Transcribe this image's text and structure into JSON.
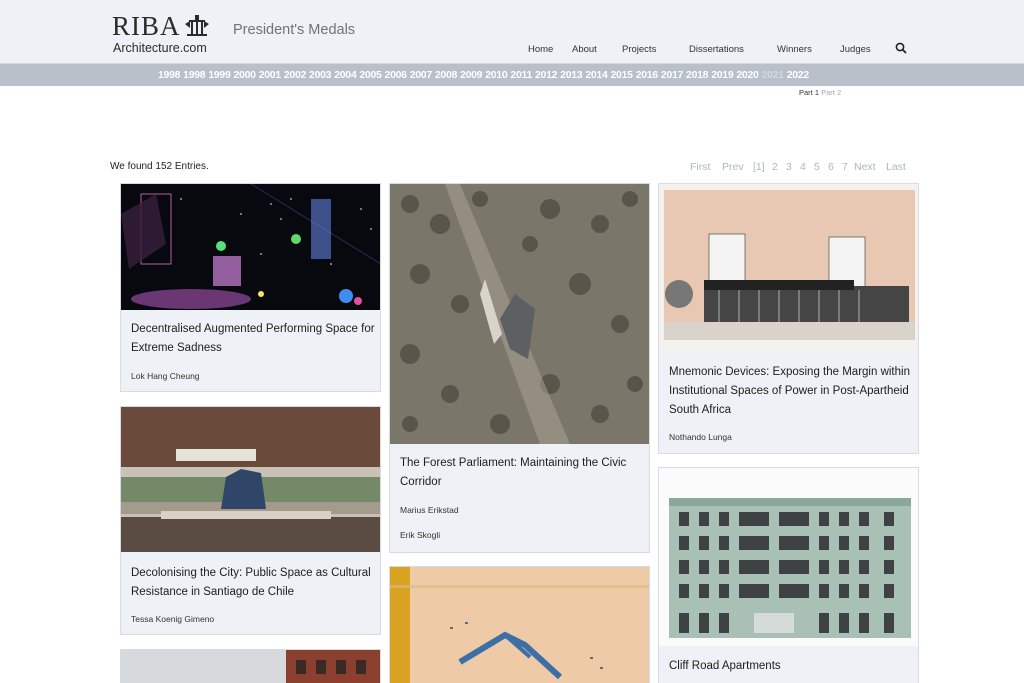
{
  "header": {
    "logo_riba": "RIBA",
    "logo_sub": "Architecture.com",
    "site_title": "President's Medals"
  },
  "nav": {
    "items": [
      {
        "label": "Home"
      },
      {
        "label": "About"
      },
      {
        "label": "Projects"
      },
      {
        "label": "Dissertations"
      },
      {
        "label": "Winners"
      },
      {
        "label": "Judges"
      }
    ],
    "search_icon": "search-icon"
  },
  "years": [
    {
      "label": "1998",
      "active": true
    },
    {
      "label": "1998",
      "active": true
    },
    {
      "label": "1999",
      "active": true
    },
    {
      "label": "2000",
      "active": true
    },
    {
      "label": "2001",
      "active": true
    },
    {
      "label": "2002",
      "active": true
    },
    {
      "label": "2003",
      "active": true
    },
    {
      "label": "2004",
      "active": true
    },
    {
      "label": "2005",
      "active": true
    },
    {
      "label": "2006",
      "active": true
    },
    {
      "label": "2007",
      "active": true
    },
    {
      "label": "2008",
      "active": true
    },
    {
      "label": "2009",
      "active": true
    },
    {
      "label": "2010",
      "active": true
    },
    {
      "label": "2011",
      "active": true
    },
    {
      "label": "2012",
      "active": true
    },
    {
      "label": "2013",
      "active": true
    },
    {
      "label": "2014",
      "active": true
    },
    {
      "label": "2015",
      "active": true
    },
    {
      "label": "2016",
      "active": true
    },
    {
      "label": "2017",
      "active": true
    },
    {
      "label": "2018",
      "active": true
    },
    {
      "label": "2019",
      "active": true
    },
    {
      "label": "2020",
      "active": true
    },
    {
      "label": "2021",
      "active": false
    },
    {
      "label": "2022",
      "active": true
    }
  ],
  "parts": {
    "part1": "Part 1",
    "part2": "Part 2"
  },
  "results": {
    "found_text": "We found 152 Entries."
  },
  "pager": {
    "first": "First",
    "prev": "Prev",
    "current": "[1]",
    "pages": [
      "2",
      "3",
      "4",
      "5",
      "6",
      "7"
    ],
    "next": "Next",
    "last": "Last"
  },
  "cards": [
    {
      "title": "Decentralised Augmented Performing Space for Extreme Sadness",
      "authors": [
        "Lok Hang Cheung"
      ]
    },
    {
      "title": "Decolonising the City: Public Space as Cultural Resistance in Santiago de Chile",
      "authors": [
        "Tessa Koenig Gimeno"
      ]
    },
    {
      "title": "The Forest Parliament: Maintaining the Civic Corridor",
      "authors": [
        "Marius Erikstad",
        "Erik Skogli"
      ]
    },
    {
      "title": "Mnemonic Devices: Exposing the Margin within Institutional Spaces of Power in Post-Apartheid South Africa",
      "authors": [
        "Nothando Lunga"
      ]
    },
    {
      "title": "Cliff Road Apartments",
      "authors": []
    }
  ],
  "colors": {
    "header_bg": "#eef1f5",
    "yearbar_bg": "#b9c0ca",
    "card_bg": "#eef1f5",
    "pager_text": "#b0b6bd"
  }
}
